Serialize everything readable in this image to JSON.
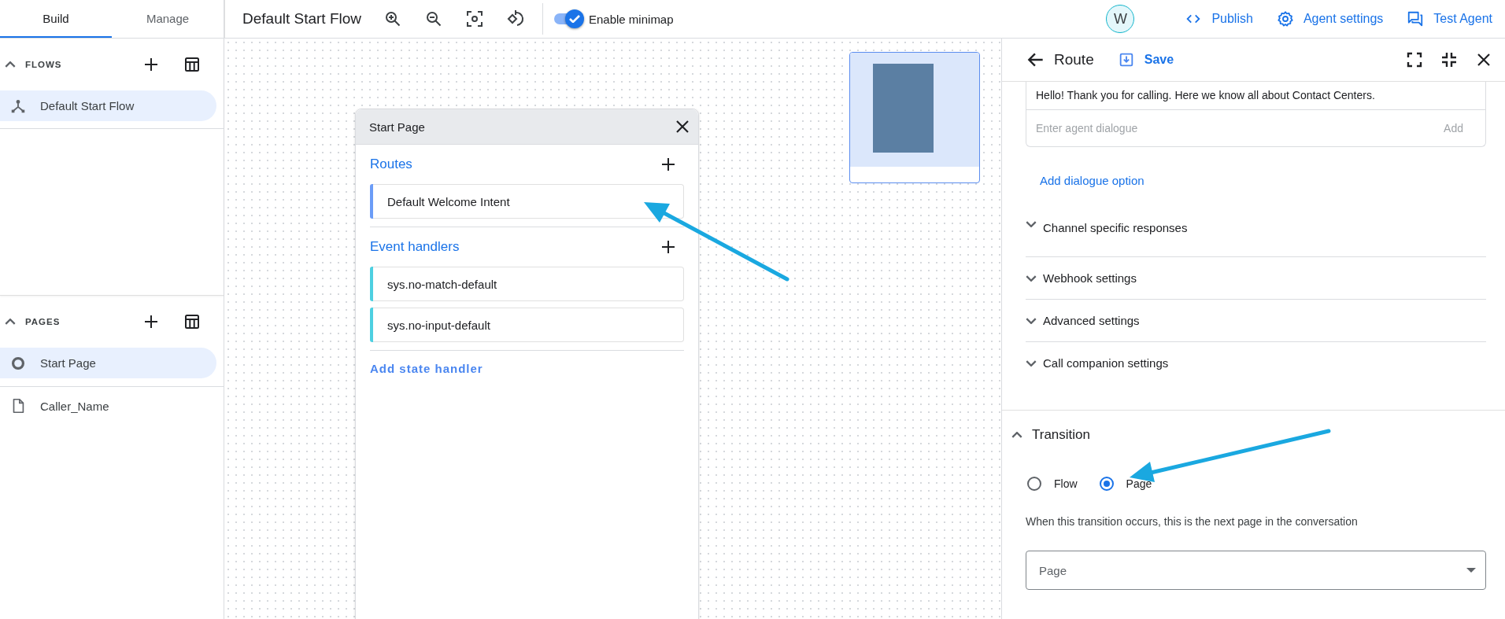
{
  "sidebar": {
    "tabs": [
      {
        "label": "Build",
        "selected": true
      },
      {
        "label": "Manage",
        "selected": false
      }
    ],
    "sections": [
      {
        "kind": "flows",
        "title": "FLOWS",
        "expanded": true,
        "items": [
          {
            "label": "Default Start Flow",
            "kind": "flow",
            "selected": true
          }
        ]
      },
      {
        "kind": "pages",
        "title": "PAGES",
        "expanded": true,
        "items": [
          {
            "label": "Start Page",
            "kind": "start",
            "selected": true
          },
          {
            "label": "Caller_Name",
            "kind": "page",
            "selected": false
          }
        ]
      }
    ]
  },
  "toolbar": {
    "title": "Default Start Flow",
    "minimap": {
      "label": "Enable minimap",
      "on": true
    }
  },
  "avatar": {
    "initial": "W"
  },
  "header_actions": [
    {
      "kind": "publish",
      "label": "Publish"
    },
    {
      "kind": "settings",
      "label": "Agent settings"
    },
    {
      "kind": "test",
      "label": "Test Agent"
    }
  ],
  "page_node": {
    "title": "Start Page",
    "sections": [
      {
        "title": "Routes",
        "items": [
          {
            "label": "Default Welcome Intent",
            "color": "#6b9cf7"
          }
        ]
      },
      {
        "title": "Event handlers",
        "items": [
          {
            "label": "sys.no-match-default",
            "color": "#4dd0e1"
          },
          {
            "label": "sys.no-input-default",
            "color": "#4dd0e1"
          }
        ]
      }
    ],
    "add_link": "Add state handler"
  },
  "route_panel": {
    "title": "Route",
    "save": "Save",
    "dialogue": {
      "messages": [
        "Hello! Thank you for calling. Here we know all about Contact Centers."
      ],
      "placeholder": "Enter agent dialogue",
      "add": "Add"
    },
    "add_option": "Add dialogue option",
    "panels": [
      {
        "title": "Channel specific responses",
        "expanded": false
      },
      {
        "title": "Webhook settings",
        "expanded": false
      },
      {
        "title": "Advanced settings",
        "expanded": false
      },
      {
        "title": "Call companion settings",
        "expanded": false
      }
    ],
    "transition": {
      "title": "Transition",
      "expanded": true,
      "options": [
        {
          "label": "Flow",
          "selected": false
        },
        {
          "label": "Page",
          "selected": true
        }
      ],
      "hint": "When this transition occurs, this is the next page in the conversation",
      "select": {
        "placeholder": "Page"
      }
    }
  }
}
